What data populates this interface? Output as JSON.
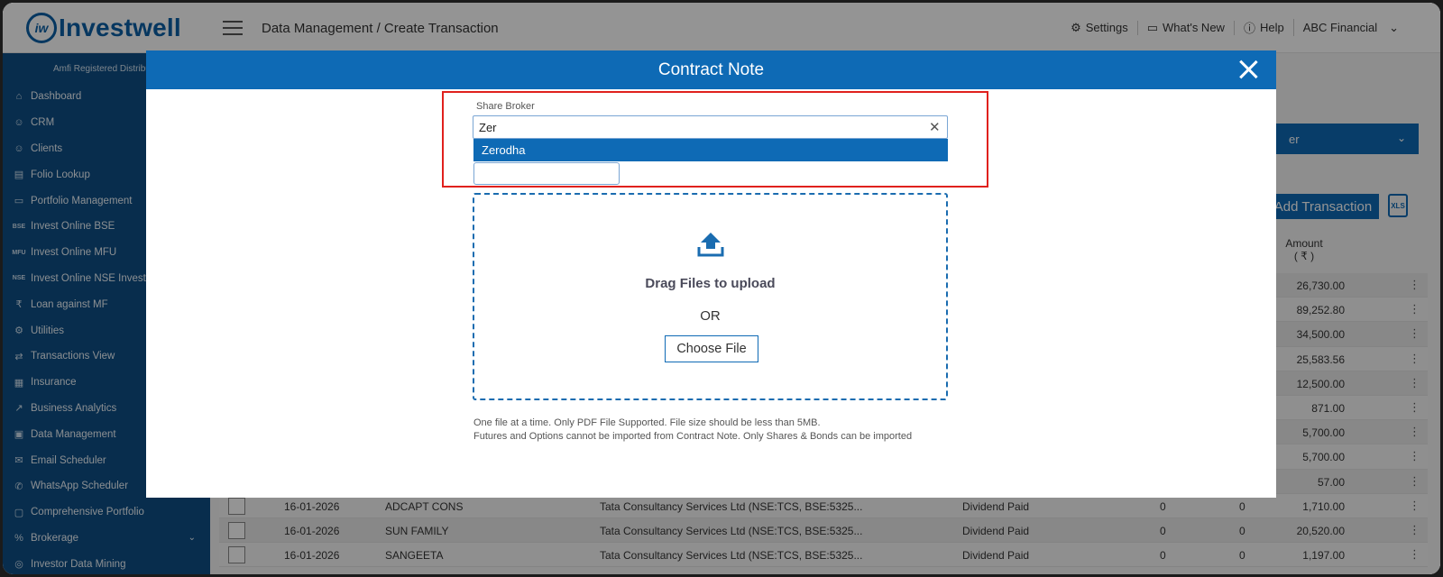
{
  "app": {
    "logo_mark": "iw",
    "logo_text": "Investwell",
    "breadcrumb": "Data Management / Create Transaction"
  },
  "topbar": {
    "settings": "Settings",
    "whats_new": "What's New",
    "help": "Help",
    "account": "ABC Financial"
  },
  "sidebar": {
    "amfi": "Amfi Registered Distributor",
    "items": [
      {
        "label": "Dashboard",
        "icon": "home-icon",
        "glyph": "⌂"
      },
      {
        "label": "CRM",
        "icon": "people-icon",
        "glyph": "☺"
      },
      {
        "label": "Clients",
        "icon": "clients-icon",
        "glyph": "☺"
      },
      {
        "label": "Folio Lookup",
        "icon": "folio-icon",
        "glyph": "▤"
      },
      {
        "label": "Portfolio Management",
        "icon": "briefcase-icon",
        "glyph": "▭"
      },
      {
        "label": "Invest Online BSE",
        "icon": "bse-icon",
        "glyph": "BSE"
      },
      {
        "label": "Invest Online MFU",
        "icon": "mfu-icon",
        "glyph": "MFU"
      },
      {
        "label": "Invest Online NSE Invest",
        "icon": "nse-icon",
        "glyph": "NSE"
      },
      {
        "label": "Loan against MF",
        "icon": "loan-icon",
        "glyph": "₹"
      },
      {
        "label": "Utilities",
        "icon": "utilities-icon",
        "glyph": "⚙"
      },
      {
        "label": "Transactions View",
        "icon": "transactions-icon",
        "glyph": "⇄"
      },
      {
        "label": "Insurance",
        "icon": "insurance-icon",
        "glyph": "▦"
      },
      {
        "label": "Business Analytics",
        "icon": "analytics-icon",
        "glyph": "↗"
      },
      {
        "label": "Data Management",
        "icon": "data-icon",
        "glyph": "▣"
      },
      {
        "label": "Email Scheduler",
        "icon": "email-icon",
        "glyph": "✉"
      },
      {
        "label": "WhatsApp Scheduler",
        "icon": "whatsapp-icon",
        "glyph": "✆"
      },
      {
        "label": "Comprehensive Portfolio",
        "icon": "portfolio-icon",
        "glyph": "▢"
      },
      {
        "label": "Brokerage",
        "icon": "brokerage-icon",
        "glyph": "%"
      },
      {
        "label": "Investor Data Mining",
        "icon": "mining-icon",
        "glyph": "◎"
      }
    ]
  },
  "content": {
    "select_partial": "er",
    "add_transaction": "Add Transaction",
    "xls": "XLS",
    "amount_header": "Amount",
    "amount_unit": "( ₹ )",
    "rows": [
      {
        "date": "",
        "client": "",
        "scrip": "",
        "type": "",
        "q1": "",
        "q2": "",
        "amount": "26,730.00"
      },
      {
        "date": "",
        "client": "",
        "scrip": "",
        "type": "",
        "q1": "",
        "q2": "",
        "amount": "89,252.80"
      },
      {
        "date": "",
        "client": "",
        "scrip": "",
        "type": "",
        "q1": "",
        "q2": "",
        "amount": "34,500.00"
      },
      {
        "date": "",
        "client": "",
        "scrip": "",
        "type": "",
        "q1": "",
        "q2": "",
        "amount": "25,583.56"
      },
      {
        "date": "",
        "client": "",
        "scrip": "",
        "type": "",
        "q1": "",
        "q2": "",
        "amount": "12,500.00"
      },
      {
        "date": "",
        "client": "",
        "scrip": "",
        "type": "",
        "q1": "",
        "q2": "",
        "amount": "871.00"
      },
      {
        "date": "",
        "client": "",
        "scrip": "",
        "type": "",
        "q1": "",
        "q2": "",
        "amount": "5,700.00"
      },
      {
        "date": "",
        "client": "",
        "scrip": "",
        "type": "",
        "q1": "",
        "q2": "",
        "amount": "5,700.00"
      },
      {
        "date": "",
        "client": "",
        "scrip": "",
        "type": "",
        "q1": "",
        "q2": "",
        "amount": "57.00"
      },
      {
        "date": "16-01-2026",
        "client": "ADCAPT CONS",
        "scrip": "Tata Consultancy Services Ltd (NSE:TCS, BSE:5325...",
        "type": "Dividend Paid",
        "q1": "0",
        "q2": "0",
        "amount": "1,710.00"
      },
      {
        "date": "16-01-2026",
        "client": "SUN FAMILY",
        "scrip": "Tata Consultancy Services Ltd (NSE:TCS, BSE:5325...",
        "type": "Dividend Paid",
        "q1": "0",
        "q2": "0",
        "amount": "20,520.00"
      },
      {
        "date": "16-01-2026",
        "client": "SANGEETA",
        "scrip": "Tata Consultancy Services Ltd (NSE:TCS, BSE:5325...",
        "type": "Dividend Paid",
        "q1": "0",
        "q2": "0",
        "amount": "1,197.00"
      }
    ]
  },
  "modal": {
    "title": "Contract Note",
    "share_broker_label": "Share Broker",
    "broker_input_value": "Zer",
    "option": "Zerodha",
    "drag_text": "Drag Files to upload",
    "or_text": "OR",
    "choose_file": "Choose File",
    "note1": "One file at a time. Only PDF File Supported. File size should be less than 5MB.",
    "note2": "Futures and Options cannot be imported from Contract Note. Only Shares & Bonds can be imported"
  },
  "colors": {
    "brand": "#0e6ab5",
    "sidebar": "#0e4f86",
    "highlight": "#e0211d"
  }
}
